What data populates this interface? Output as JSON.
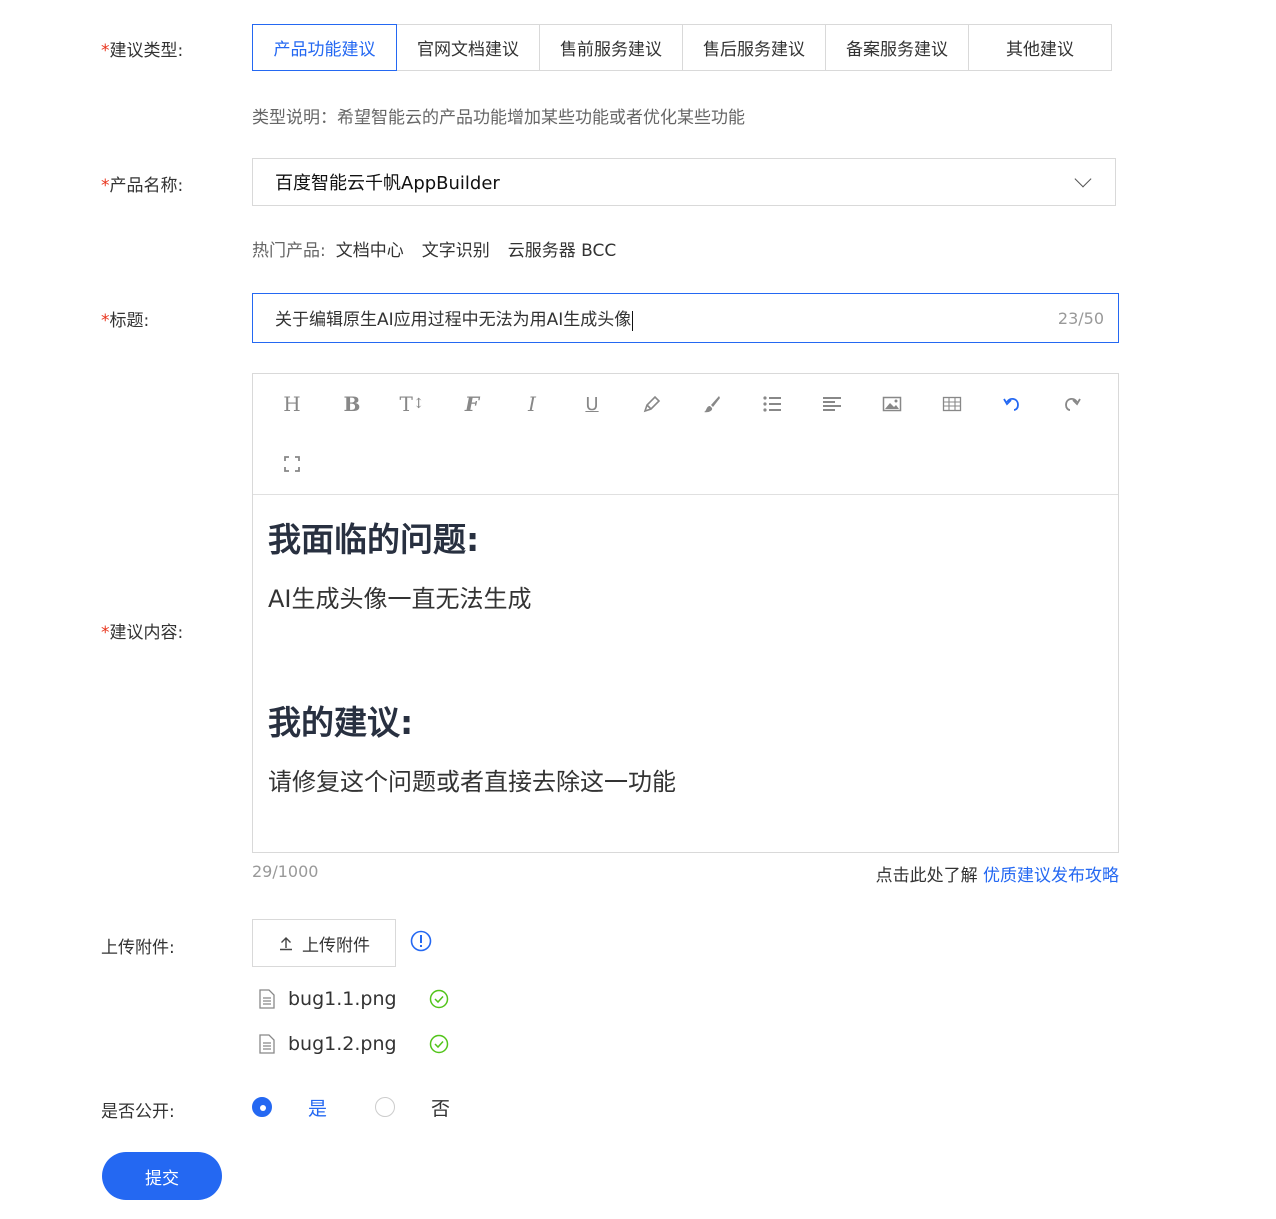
{
  "form": {
    "type_label": "建议类型:",
    "type_tabs": [
      "产品功能建议",
      "官网文档建议",
      "售前服务建议",
      "售后服务建议",
      "备案服务建议",
      "其他建议"
    ],
    "type_desc": "类型说明：希望智能云的产品功能增加某些功能或者优化某些功能",
    "product_label": "产品名称:",
    "product_value": "百度智能云千帆AppBuilder",
    "hot_label": "热门产品:",
    "hot_items": [
      "文档中心",
      "文字识别",
      "云服务器 BCC"
    ],
    "title_label": "标题:",
    "title_value": "关于编辑原生AI应用过程中无法为用AI生成头像",
    "title_count": "23/50",
    "content_label": "建议内容:",
    "content": {
      "heading1": "我面临的问题:",
      "text1": "AI生成头像一直无法生成",
      "heading2": "我的建议:",
      "text2": "请修复这个问题或者直接去除这一功能"
    },
    "content_count": "29/1000",
    "guide_prefix": "点击此处了解",
    "guide_link": "优质建议发布攻略",
    "attach_label": "上传附件:",
    "attach_button": "上传附件",
    "files": [
      "bug1.1.png",
      "bug1.2.png"
    ],
    "public_label": "是否公开:",
    "public_yes": "是",
    "public_no": "否",
    "submit": "提交"
  },
  "toolbar_icons": [
    "heading-icon",
    "bold-icon",
    "font-size-icon",
    "font-family-icon",
    "italic-icon",
    "underline-icon",
    "highlight-icon",
    "color-brush-icon",
    "list-icon",
    "align-icon",
    "image-icon",
    "table-icon",
    "undo-icon",
    "redo-icon",
    "fullscreen-icon"
  ],
  "colors": {
    "accent": "#2468f2",
    "required": "#e8341c",
    "success": "#52c41a"
  }
}
